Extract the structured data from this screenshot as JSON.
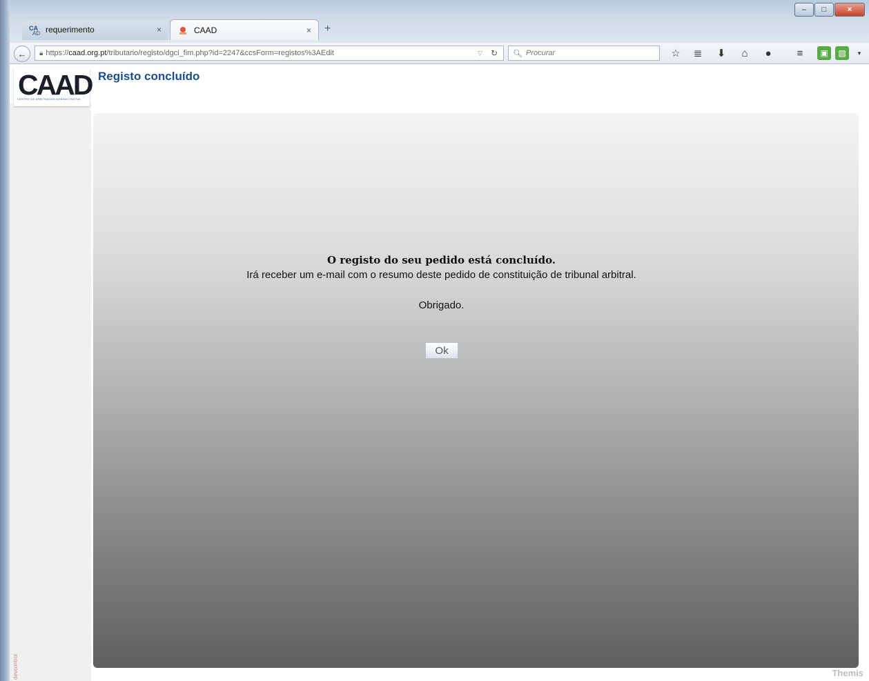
{
  "browser": {
    "tabs": [
      {
        "label": "requerimento",
        "close": "×",
        "active": false
      },
      {
        "label": "CAAD",
        "close": "×",
        "active": true
      }
    ],
    "new_tab": "+",
    "url": {
      "scheme": "https://",
      "host": "caad.org.pt",
      "path": "/tributario/registo/dgci_fim.php?id=2247&ccsForm=registos%3AEdit"
    },
    "search_placeholder": "Procurar",
    "window_controls": {
      "minimize": "–",
      "maximize": "□",
      "close": "×"
    }
  },
  "header": {
    "logo_text": "CAAD",
    "logo_subtitle": "CENTRO DE ARBITRAGEM ADMINISTRATIVA",
    "page_title": "Registo concluído"
  },
  "message": {
    "headline": "O registo do seu pedido está concluído.",
    "body": "Irá receber um e-mail com o resumo deste pedido de constituição de tribunal arbitral.",
    "thanks": "Obrigado.",
    "ok_label": "Ok"
  },
  "footer": {
    "brand": "Themis",
    "side_text": "devcontrol"
  },
  "colors": {
    "title": "#1a4d8f",
    "panel_top": "#f4f4f4",
    "panel_bottom": "#5f5f5f"
  }
}
